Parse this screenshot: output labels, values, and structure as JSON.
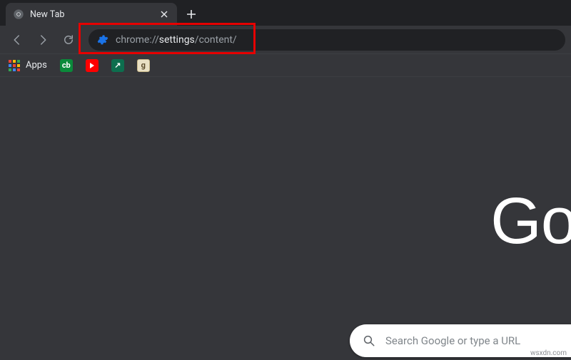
{
  "tab": {
    "title": "New Tab"
  },
  "omnibox": {
    "prefix": "chrome://",
    "highlight": "settings",
    "suffix": "/content/"
  },
  "bookmarks": {
    "apps_label": "Apps",
    "items": [
      {
        "glyph": "cb"
      },
      {
        "glyph": ""
      },
      {
        "glyph": "↗"
      },
      {
        "glyph": "g"
      }
    ]
  },
  "content": {
    "logo_text": "Go",
    "search_placeholder": "Search Google or type a URL"
  },
  "watermark": "wsxdn.com"
}
